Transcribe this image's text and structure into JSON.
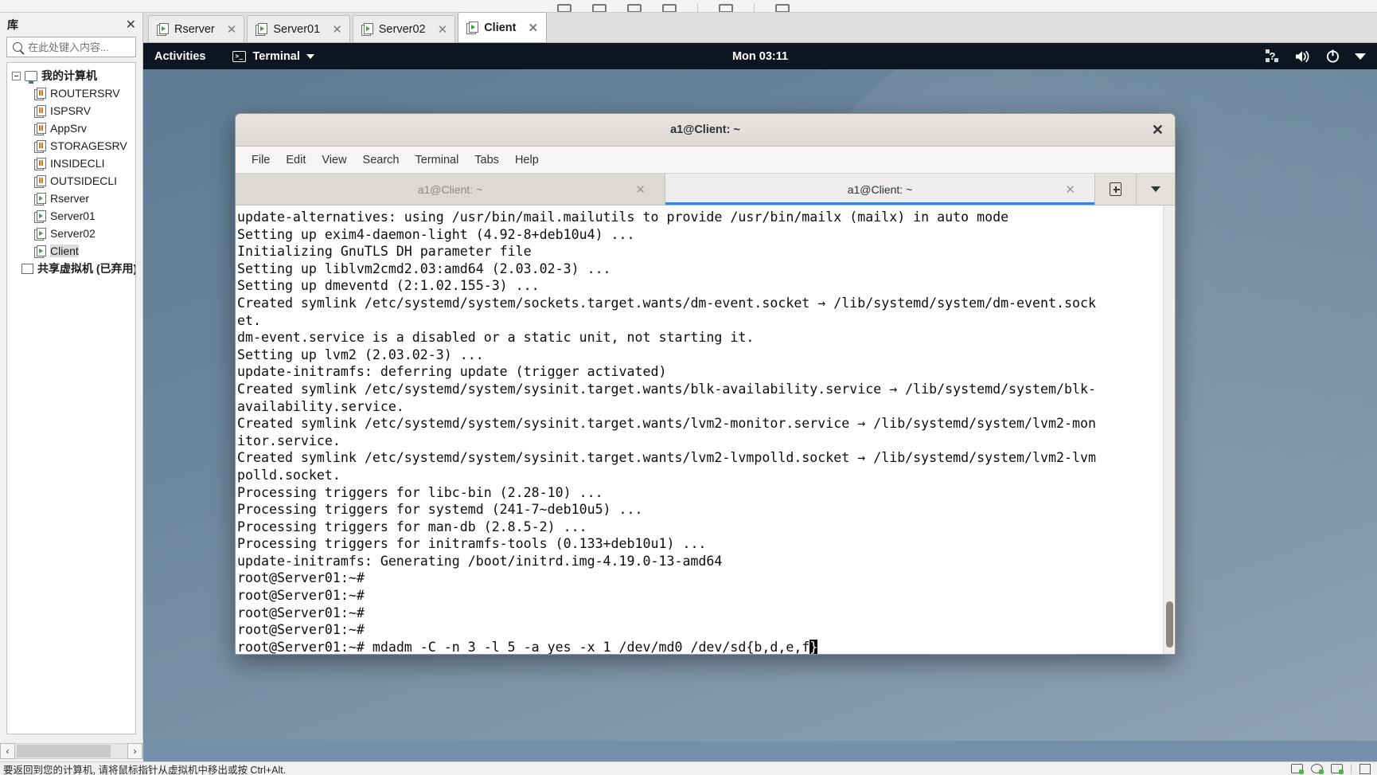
{
  "vmware": {
    "library": {
      "title": "库",
      "close_label": "✕",
      "search_placeholder": "在此处键入内容...",
      "root_label": "我的计算机",
      "items": [
        {
          "label": "ROUTERSRV",
          "state": "suspended"
        },
        {
          "label": "ISPSRV",
          "state": "suspended"
        },
        {
          "label": "AppSrv",
          "state": "suspended"
        },
        {
          "label": "STORAGESRV",
          "state": "suspended"
        },
        {
          "label": "INSIDECLI",
          "state": "suspended"
        },
        {
          "label": "OUTSIDECLI",
          "state": "suspended"
        },
        {
          "label": "Rserver",
          "state": "running"
        },
        {
          "label": "Server01",
          "state": "running"
        },
        {
          "label": "Server02",
          "state": "running"
        },
        {
          "label": "Client",
          "state": "running",
          "selected": true
        }
      ],
      "shared_label": "共享虚拟机 (已弃用)"
    },
    "tabs": [
      {
        "label": "Rserver",
        "active": false,
        "close": "✕"
      },
      {
        "label": "Server01",
        "active": false,
        "close": "✕"
      },
      {
        "label": "Server02",
        "active": false,
        "close": "✕"
      },
      {
        "label": "Client",
        "active": true,
        "close": "✕"
      }
    ],
    "statusbar": {
      "message": "要返回到您的计算机, 请将鼠标指针从虚拟机中移出或按 Ctrl+Alt."
    }
  },
  "gnome": {
    "activities": "Activities",
    "app_name": "Terminal",
    "clock": "Mon 03:11",
    "tray": {
      "accessibility": "accessibility-icon",
      "volume": "volume-icon",
      "power": "power-icon",
      "menu": "chevron-down-icon"
    }
  },
  "terminal": {
    "title": "a1@Client: ~",
    "close_label": "✕",
    "menus": [
      "File",
      "Edit",
      "View",
      "Search",
      "Terminal",
      "Tabs",
      "Help"
    ],
    "tabs": [
      {
        "label": "a1@Client: ~",
        "active": false,
        "close": "✕"
      },
      {
        "label": "a1@Client: ~",
        "active": true,
        "close": "✕"
      }
    ],
    "new_tab_label": "new-tab-button",
    "tab_menu_label": "tab-list-button",
    "lines": [
      "update-alternatives: using /usr/bin/mail.mailutils to provide /usr/bin/mailx (mailx) in auto mode",
      "Setting up exim4-daemon-light (4.92-8+deb10u4) ...",
      "Initializing GnuTLS DH parameter file",
      "Setting up liblvm2cmd2.03:amd64 (2.03.02-3) ...",
      "Setting up dmeventd (2:1.02.155-3) ...",
      "Created symlink /etc/systemd/system/sockets.target.wants/dm-event.socket → /lib/systemd/system/dm-event.sock",
      "et.",
      "dm-event.service is a disabled or a static unit, not starting it.",
      "Setting up lvm2 (2.03.02-3) ...",
      "update-initramfs: deferring update (trigger activated)",
      "Created symlink /etc/systemd/system/sysinit.target.wants/blk-availability.service → /lib/systemd/system/blk-",
      "availability.service.",
      "Created symlink /etc/systemd/system/sysinit.target.wants/lvm2-monitor.service → /lib/systemd/system/lvm2-mon",
      "itor.service.",
      "Created symlink /etc/systemd/system/sysinit.target.wants/lvm2-lvmpolld.socket → /lib/systemd/system/lvm2-lvm",
      "polld.socket.",
      "Processing triggers for libc-bin (2.28-10) ...",
      "Processing triggers for systemd (241-7~deb10u5) ...",
      "Processing triggers for man-db (2.8.5-2) ...",
      "Processing triggers for initramfs-tools (0.133+deb10u1) ...",
      "update-initramfs: Generating /boot/initrd.img-4.19.0-13-amd64",
      "root@Server01:~#",
      "root@Server01:~#",
      "root@Server01:~#",
      "root@Server01:~#"
    ],
    "prompt": "root@Server01:~# ",
    "command_before_cursor": "mdadm -C -n 3 -l 5 -a yes -x 1 /dev/md0 /dev/sd{b,d,e,f",
    "cursor_char": "}"
  },
  "colors": {
    "gnome_bar": "#0d1521",
    "tab_accent": "#3584e4",
    "desktop": "#6d879d",
    "vm_status_fill": "#7590a8"
  }
}
